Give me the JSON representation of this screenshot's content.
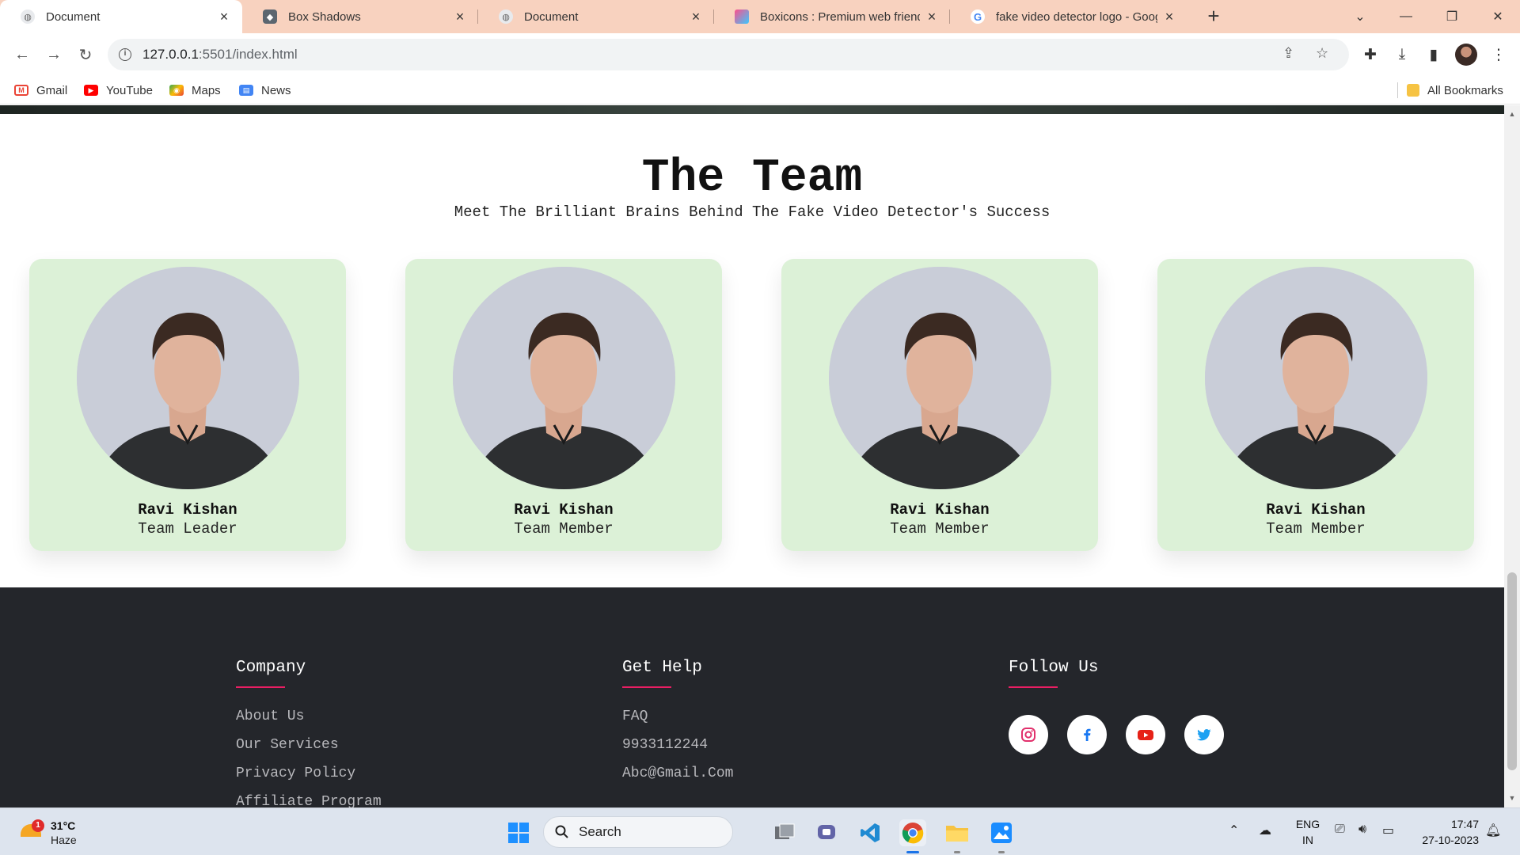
{
  "browser": {
    "tabs": [
      {
        "title": "Document",
        "active": true
      },
      {
        "title": "Box Shadows",
        "active": false
      },
      {
        "title": "Document",
        "active": false
      },
      {
        "title": "Boxicons : Premium web friendly",
        "active": false
      },
      {
        "title": "fake video detector logo - Goog",
        "active": false
      }
    ],
    "url_host": "127.0.0.1",
    "url_path": ":5501/index.html",
    "bookmarks": [
      "Gmail",
      "YouTube",
      "Maps",
      "News"
    ],
    "all_bookmarks": "All Bookmarks"
  },
  "team": {
    "title": "The Team",
    "subtitle": "Meet The Brilliant Brains Behind The Fake Video Detector's Success",
    "members": [
      {
        "name": "Ravi Kishan",
        "role": "Team Leader"
      },
      {
        "name": "Ravi Kishan",
        "role": "Team Member"
      },
      {
        "name": "Ravi Kishan",
        "role": "Team Member"
      },
      {
        "name": "Ravi Kishan",
        "role": "Team Member"
      }
    ]
  },
  "footer": {
    "company": {
      "heading": "Company",
      "links": [
        "About Us",
        "Our Services",
        "Privacy Policy",
        "Affiliate Program"
      ]
    },
    "help": {
      "heading": "Get Help",
      "links": [
        "FAQ",
        "9933112244",
        "Abc@Gmail.Com"
      ]
    },
    "follow": {
      "heading": "Follow Us",
      "icons": [
        "instagram-icon",
        "facebook-icon",
        "youtube-icon",
        "twitter-icon"
      ]
    },
    "accent_color": "#e91e63",
    "background_color": "#24262b"
  },
  "taskbar": {
    "weather_temp": "31°C",
    "weather_desc": "Haze",
    "weather_badge": "1",
    "search_label": "Search",
    "lang_line1": "ENG",
    "lang_line2": "IN",
    "time": "17:47",
    "date": "27-10-2023"
  }
}
